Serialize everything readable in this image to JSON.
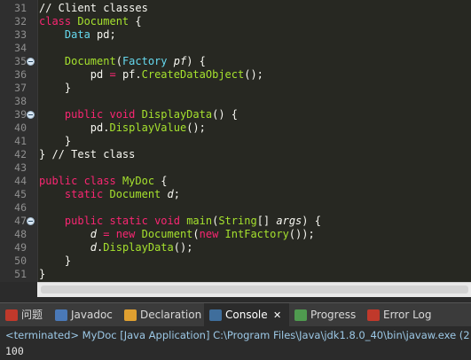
{
  "editor": {
    "lines": [
      {
        "no": "31",
        "fold": false,
        "tokens": [
          [
            "// Client classes",
            "cm"
          ]
        ]
      },
      {
        "no": "32",
        "fold": false,
        "tokens": [
          [
            "class ",
            "kw"
          ],
          [
            "Document",
            "fn"
          ],
          [
            " {",
            "pu"
          ]
        ]
      },
      {
        "no": "33",
        "fold": false,
        "tokens": [
          [
            "    ",
            "pu"
          ],
          [
            "Data ",
            "ty"
          ],
          [
            "pd;",
            "va"
          ]
        ]
      },
      {
        "no": "34",
        "fold": false,
        "tokens": []
      },
      {
        "no": "35",
        "fold": true,
        "tokens": [
          [
            "    ",
            "pu"
          ],
          [
            "Document",
            "fn"
          ],
          [
            "(",
            "pu"
          ],
          [
            "Factory ",
            "ty"
          ],
          [
            "pf",
            "va it"
          ],
          [
            ") {",
            "pu"
          ]
        ]
      },
      {
        "no": "36",
        "fold": false,
        "tokens": [
          [
            "        ",
            "pu"
          ],
          [
            "pd ",
            "va"
          ],
          [
            "= ",
            "kw"
          ],
          [
            "pf",
            "va"
          ],
          [
            ".",
            "pu"
          ],
          [
            "CreateDataObject",
            "fn"
          ],
          [
            "();",
            "pu"
          ]
        ]
      },
      {
        "no": "37",
        "fold": false,
        "tokens": [
          [
            "    }",
            "pu"
          ]
        ]
      },
      {
        "no": "38",
        "fold": false,
        "tokens": []
      },
      {
        "no": "39",
        "fold": true,
        "tokens": [
          [
            "    ",
            "pu"
          ],
          [
            "public ",
            "kw"
          ],
          [
            "void ",
            "kw"
          ],
          [
            "DisplayData",
            "fn"
          ],
          [
            "() {",
            "pu"
          ]
        ]
      },
      {
        "no": "40",
        "fold": false,
        "tokens": [
          [
            "        ",
            "pu"
          ],
          [
            "pd",
            "va"
          ],
          [
            ".",
            "pu"
          ],
          [
            "DisplayValue",
            "fn"
          ],
          [
            "();",
            "pu"
          ]
        ]
      },
      {
        "no": "41",
        "fold": false,
        "tokens": [
          [
            "    }",
            "pu"
          ]
        ]
      },
      {
        "no": "42",
        "fold": false,
        "tokens": [
          [
            "} // Test class",
            "cm"
          ]
        ]
      },
      {
        "no": "43",
        "fold": false,
        "tokens": []
      },
      {
        "no": "44",
        "fold": false,
        "tokens": [
          [
            "public ",
            "kw"
          ],
          [
            "class ",
            "kw"
          ],
          [
            "MyDoc ",
            "fn"
          ],
          [
            "{",
            "pu"
          ]
        ]
      },
      {
        "no": "45",
        "fold": false,
        "tokens": [
          [
            "    ",
            "pu"
          ],
          [
            "static ",
            "kw"
          ],
          [
            "Document ",
            "fn"
          ],
          [
            "d",
            "va it"
          ],
          [
            ";",
            "pu"
          ]
        ]
      },
      {
        "no": "46",
        "fold": false,
        "tokens": []
      },
      {
        "no": "47",
        "fold": true,
        "tokens": [
          [
            "    ",
            "pu"
          ],
          [
            "public ",
            "kw"
          ],
          [
            "static ",
            "kw"
          ],
          [
            "void ",
            "kw"
          ],
          [
            "main",
            "fn"
          ],
          [
            "(",
            "pu"
          ],
          [
            "String",
            "fn"
          ],
          [
            "[] ",
            "pu"
          ],
          [
            "args",
            "va it"
          ],
          [
            ") {",
            "pu"
          ]
        ]
      },
      {
        "no": "48",
        "fold": false,
        "tokens": [
          [
            "        ",
            "pu"
          ],
          [
            "d ",
            "va it"
          ],
          [
            "= ",
            "kw"
          ],
          [
            "new ",
            "kw"
          ],
          [
            "Document",
            "fn"
          ],
          [
            "(",
            "pu"
          ],
          [
            "new ",
            "kw"
          ],
          [
            "IntFactory",
            "fn"
          ],
          [
            "());",
            "pu"
          ]
        ]
      },
      {
        "no": "49",
        "fold": false,
        "tokens": [
          [
            "        ",
            "pu"
          ],
          [
            "d",
            "va it"
          ],
          [
            ".",
            "pu"
          ],
          [
            "DisplayData",
            "fn"
          ],
          [
            "();",
            "pu"
          ]
        ]
      },
      {
        "no": "50",
        "fold": false,
        "tokens": [
          [
            "    }",
            "pu"
          ]
        ]
      },
      {
        "no": "51",
        "fold": false,
        "tokens": [
          [
            "}",
            "pu"
          ]
        ]
      }
    ]
  },
  "tabs": [
    {
      "label": "问题",
      "icon": "problems-icon",
      "color": "#c0392b",
      "active": false
    },
    {
      "label": "Javadoc",
      "icon": "javadoc-icon",
      "color": "#4a79b8",
      "active": false
    },
    {
      "label": "Declaration",
      "icon": "declaration-icon",
      "color": "#e0a030",
      "active": false
    },
    {
      "label": "Console",
      "icon": "console-icon",
      "color": "#3f6e9c",
      "active": true,
      "close": "✕"
    },
    {
      "label": "Progress",
      "icon": "progress-icon",
      "color": "#4f9a4f",
      "active": false
    },
    {
      "label": "Error Log",
      "icon": "error-log-icon",
      "color": "#c0392b",
      "active": false
    }
  ],
  "console": {
    "terminated": "<terminated> MyDoc [Java Application] C:\\Program Files\\Java\\jdk1.8.0_40\\bin\\javaw.exe (2",
    "output": "100"
  }
}
